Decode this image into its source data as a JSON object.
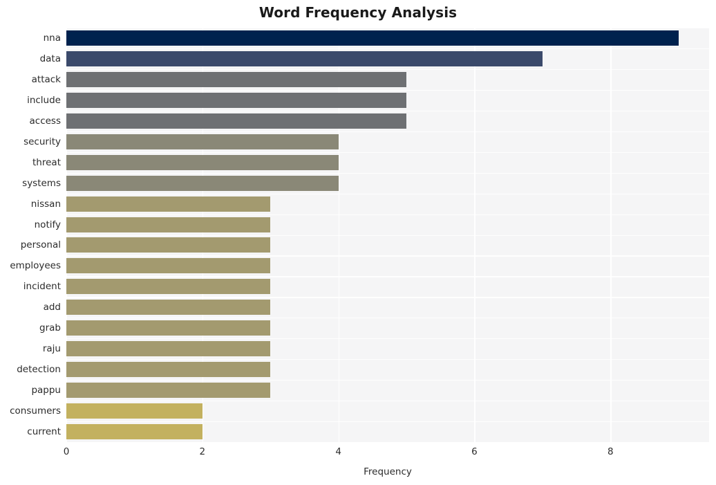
{
  "chart_data": {
    "type": "bar",
    "orientation": "horizontal",
    "title": "Word Frequency Analysis",
    "xlabel": "Frequency",
    "ylabel": "",
    "categories": [
      "nna",
      "data",
      "attack",
      "include",
      "access",
      "security",
      "threat",
      "systems",
      "nissan",
      "notify",
      "personal",
      "employees",
      "incident",
      "add",
      "grab",
      "raju",
      "detection",
      "pappu",
      "consumers",
      "current"
    ],
    "values": [
      9,
      7,
      5,
      5,
      5,
      4,
      4,
      4,
      3,
      3,
      3,
      3,
      3,
      3,
      3,
      3,
      3,
      3,
      2,
      2
    ],
    "bar_colors": [
      "#00224e",
      "#3b4a6b",
      "#6e7073",
      "#6e7073",
      "#6e7073",
      "#8a8877",
      "#8a8877",
      "#8a8877",
      "#a39a6f",
      "#a39a6f",
      "#a39a6f",
      "#a39a6f",
      "#a39a6f",
      "#a39a6f",
      "#a39a6f",
      "#a39a6f",
      "#a39a6f",
      "#a39a6f",
      "#c3b15f",
      "#c3b15f"
    ],
    "xlim": [
      0,
      9.45
    ],
    "xticks": [
      0,
      2,
      4,
      6,
      8
    ],
    "xtick_labels": [
      "0",
      "2",
      "4",
      "6",
      "8"
    ],
    "grid": true,
    "grid_axis": "x",
    "grid_color": "#ffffff",
    "plot_background": "#f5f5f6",
    "figure_background": "#ffffff",
    "legend": null
  }
}
